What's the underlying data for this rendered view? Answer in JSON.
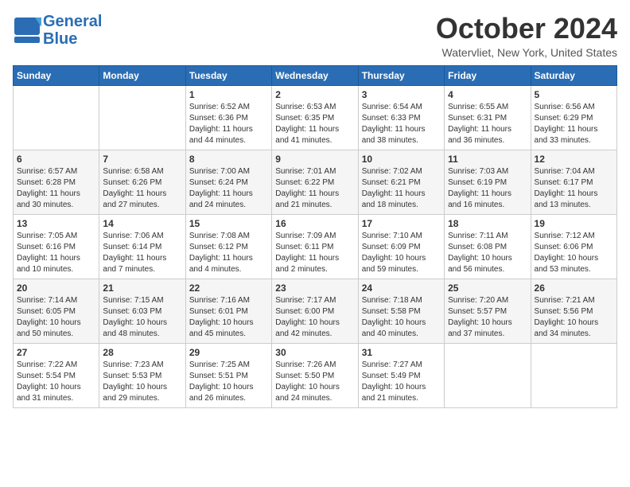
{
  "header": {
    "logo_line1": "General",
    "logo_line2": "Blue",
    "month": "October 2024",
    "location": "Watervliet, New York, United States"
  },
  "days_of_week": [
    "Sunday",
    "Monday",
    "Tuesday",
    "Wednesday",
    "Thursday",
    "Friday",
    "Saturday"
  ],
  "weeks": [
    [
      {
        "day": "",
        "details": ""
      },
      {
        "day": "",
        "details": ""
      },
      {
        "day": "1",
        "details": "Sunrise: 6:52 AM\nSunset: 6:36 PM\nDaylight: 11 hours\nand 44 minutes."
      },
      {
        "day": "2",
        "details": "Sunrise: 6:53 AM\nSunset: 6:35 PM\nDaylight: 11 hours\nand 41 minutes."
      },
      {
        "day": "3",
        "details": "Sunrise: 6:54 AM\nSunset: 6:33 PM\nDaylight: 11 hours\nand 38 minutes."
      },
      {
        "day": "4",
        "details": "Sunrise: 6:55 AM\nSunset: 6:31 PM\nDaylight: 11 hours\nand 36 minutes."
      },
      {
        "day": "5",
        "details": "Sunrise: 6:56 AM\nSunset: 6:29 PM\nDaylight: 11 hours\nand 33 minutes."
      }
    ],
    [
      {
        "day": "6",
        "details": "Sunrise: 6:57 AM\nSunset: 6:28 PM\nDaylight: 11 hours\nand 30 minutes."
      },
      {
        "day": "7",
        "details": "Sunrise: 6:58 AM\nSunset: 6:26 PM\nDaylight: 11 hours\nand 27 minutes."
      },
      {
        "day": "8",
        "details": "Sunrise: 7:00 AM\nSunset: 6:24 PM\nDaylight: 11 hours\nand 24 minutes."
      },
      {
        "day": "9",
        "details": "Sunrise: 7:01 AM\nSunset: 6:22 PM\nDaylight: 11 hours\nand 21 minutes."
      },
      {
        "day": "10",
        "details": "Sunrise: 7:02 AM\nSunset: 6:21 PM\nDaylight: 11 hours\nand 18 minutes."
      },
      {
        "day": "11",
        "details": "Sunrise: 7:03 AM\nSunset: 6:19 PM\nDaylight: 11 hours\nand 16 minutes."
      },
      {
        "day": "12",
        "details": "Sunrise: 7:04 AM\nSunset: 6:17 PM\nDaylight: 11 hours\nand 13 minutes."
      }
    ],
    [
      {
        "day": "13",
        "details": "Sunrise: 7:05 AM\nSunset: 6:16 PM\nDaylight: 11 hours\nand 10 minutes."
      },
      {
        "day": "14",
        "details": "Sunrise: 7:06 AM\nSunset: 6:14 PM\nDaylight: 11 hours\nand 7 minutes."
      },
      {
        "day": "15",
        "details": "Sunrise: 7:08 AM\nSunset: 6:12 PM\nDaylight: 11 hours\nand 4 minutes."
      },
      {
        "day": "16",
        "details": "Sunrise: 7:09 AM\nSunset: 6:11 PM\nDaylight: 11 hours\nand 2 minutes."
      },
      {
        "day": "17",
        "details": "Sunrise: 7:10 AM\nSunset: 6:09 PM\nDaylight: 10 hours\nand 59 minutes."
      },
      {
        "day": "18",
        "details": "Sunrise: 7:11 AM\nSunset: 6:08 PM\nDaylight: 10 hours\nand 56 minutes."
      },
      {
        "day": "19",
        "details": "Sunrise: 7:12 AM\nSunset: 6:06 PM\nDaylight: 10 hours\nand 53 minutes."
      }
    ],
    [
      {
        "day": "20",
        "details": "Sunrise: 7:14 AM\nSunset: 6:05 PM\nDaylight: 10 hours\nand 50 minutes."
      },
      {
        "day": "21",
        "details": "Sunrise: 7:15 AM\nSunset: 6:03 PM\nDaylight: 10 hours\nand 48 minutes."
      },
      {
        "day": "22",
        "details": "Sunrise: 7:16 AM\nSunset: 6:01 PM\nDaylight: 10 hours\nand 45 minutes."
      },
      {
        "day": "23",
        "details": "Sunrise: 7:17 AM\nSunset: 6:00 PM\nDaylight: 10 hours\nand 42 minutes."
      },
      {
        "day": "24",
        "details": "Sunrise: 7:18 AM\nSunset: 5:58 PM\nDaylight: 10 hours\nand 40 minutes."
      },
      {
        "day": "25",
        "details": "Sunrise: 7:20 AM\nSunset: 5:57 PM\nDaylight: 10 hours\nand 37 minutes."
      },
      {
        "day": "26",
        "details": "Sunrise: 7:21 AM\nSunset: 5:56 PM\nDaylight: 10 hours\nand 34 minutes."
      }
    ],
    [
      {
        "day": "27",
        "details": "Sunrise: 7:22 AM\nSunset: 5:54 PM\nDaylight: 10 hours\nand 31 minutes."
      },
      {
        "day": "28",
        "details": "Sunrise: 7:23 AM\nSunset: 5:53 PM\nDaylight: 10 hours\nand 29 minutes."
      },
      {
        "day": "29",
        "details": "Sunrise: 7:25 AM\nSunset: 5:51 PM\nDaylight: 10 hours\nand 26 minutes."
      },
      {
        "day": "30",
        "details": "Sunrise: 7:26 AM\nSunset: 5:50 PM\nDaylight: 10 hours\nand 24 minutes."
      },
      {
        "day": "31",
        "details": "Sunrise: 7:27 AM\nSunset: 5:49 PM\nDaylight: 10 hours\nand 21 minutes."
      },
      {
        "day": "",
        "details": ""
      },
      {
        "day": "",
        "details": ""
      }
    ]
  ]
}
